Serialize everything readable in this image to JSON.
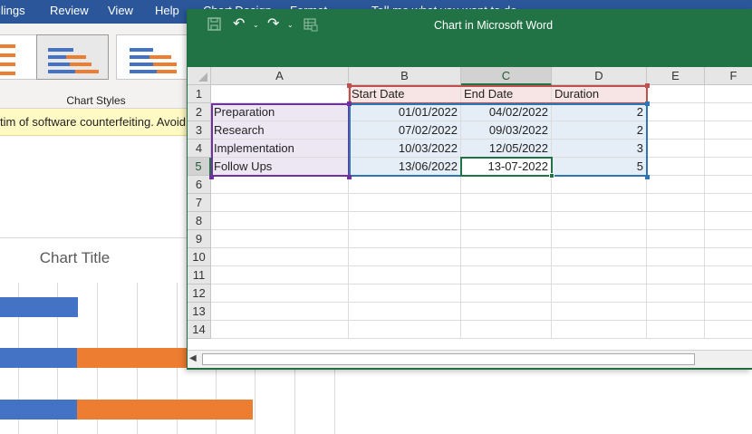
{
  "word": {
    "menu": [
      "ilings",
      "Review",
      "View",
      "Help",
      "Chart Design",
      "Format",
      "Tell me what you want to do"
    ],
    "ribbon_group_label": "Chart Styles",
    "warning_text": "tim of software counterfeiting. Avoid in",
    "chart_title": "Chart Title",
    "colors": {
      "series_start": "#4472c4",
      "series_duration": "#ed7d31",
      "ribbon_blue": "#2b579a"
    }
  },
  "excel": {
    "title": "Chart in Microsoft Word",
    "columns": [
      "A",
      "B",
      "C",
      "D",
      "E",
      "F"
    ],
    "rows": [
      "1",
      "2",
      "3",
      "4",
      "5",
      "6",
      "7",
      "8",
      "9",
      "10",
      "11",
      "12",
      "13",
      "14"
    ],
    "table": {
      "header": [
        "",
        "Start Date",
        "End Date",
        "Duration"
      ],
      "data": [
        [
          "Preparation",
          "01/01/2022",
          "04/02/2022",
          "2"
        ],
        [
          "Research",
          "07/02/2022",
          "09/03/2022",
          "2"
        ],
        [
          "Implementation",
          "10/03/2022",
          "12/05/2022",
          "3"
        ],
        [
          "Follow Ups",
          "13/06/2022",
          "13-07-2022",
          "5"
        ]
      ]
    },
    "active_cell": "C5",
    "colors": {
      "excel_green": "#217346",
      "range_names": "#7030a0",
      "range_header": "#c0504d",
      "range_values": "#2e75b6"
    }
  }
}
